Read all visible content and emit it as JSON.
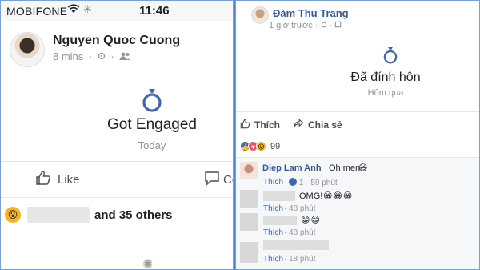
{
  "left": {
    "status_bar": {
      "carrier": "MOBIFONE",
      "time": "11:46"
    },
    "post": {
      "author": "Nguyen Quoc Cuong",
      "time": "8 mins",
      "event_title": "Got Engaged",
      "event_date": "Today",
      "like_label": "Like",
      "comment_label": "Co",
      "reactions_text": "and 35 others"
    }
  },
  "right": {
    "post": {
      "author": "Đàm Thu Trang",
      "time": "1 giờ trước",
      "event_title": "Đã đính hôn",
      "event_date": "Hôm qua",
      "like_label": "Thích",
      "share_label": "Chia sẻ",
      "reaction_count": "99"
    },
    "comments": [
      {
        "author": "Diep Lam Anh",
        "text": "Oh men",
        "emoji": "😆",
        "action": "Thích",
        "likes": "1",
        "time": "59 phút"
      },
      {
        "author": "",
        "text": "OMG!",
        "emoji": "😁😁😁",
        "action": "Thích",
        "time": "48 phút"
      },
      {
        "author": "",
        "text": "",
        "emoji": "😁😁",
        "action": "Thích",
        "time": "48 phút"
      },
      {
        "author": "",
        "text": "",
        "emoji": "",
        "action": "Thích",
        "time": "18 phút"
      }
    ]
  },
  "colors": {
    "link_blue": "#365899",
    "accent_blue": "#4267b2",
    "meta_gray": "#90949c",
    "divider_blue": "#5b7fb5"
  },
  "icons": {
    "wifi": "wifi-icon",
    "ring": "ring-icon",
    "like": "thumbs-up-icon",
    "comment": "speech-bubble-icon",
    "share": "share-arrow-icon",
    "friends": "friends-icon",
    "globe": "globe-icon"
  }
}
